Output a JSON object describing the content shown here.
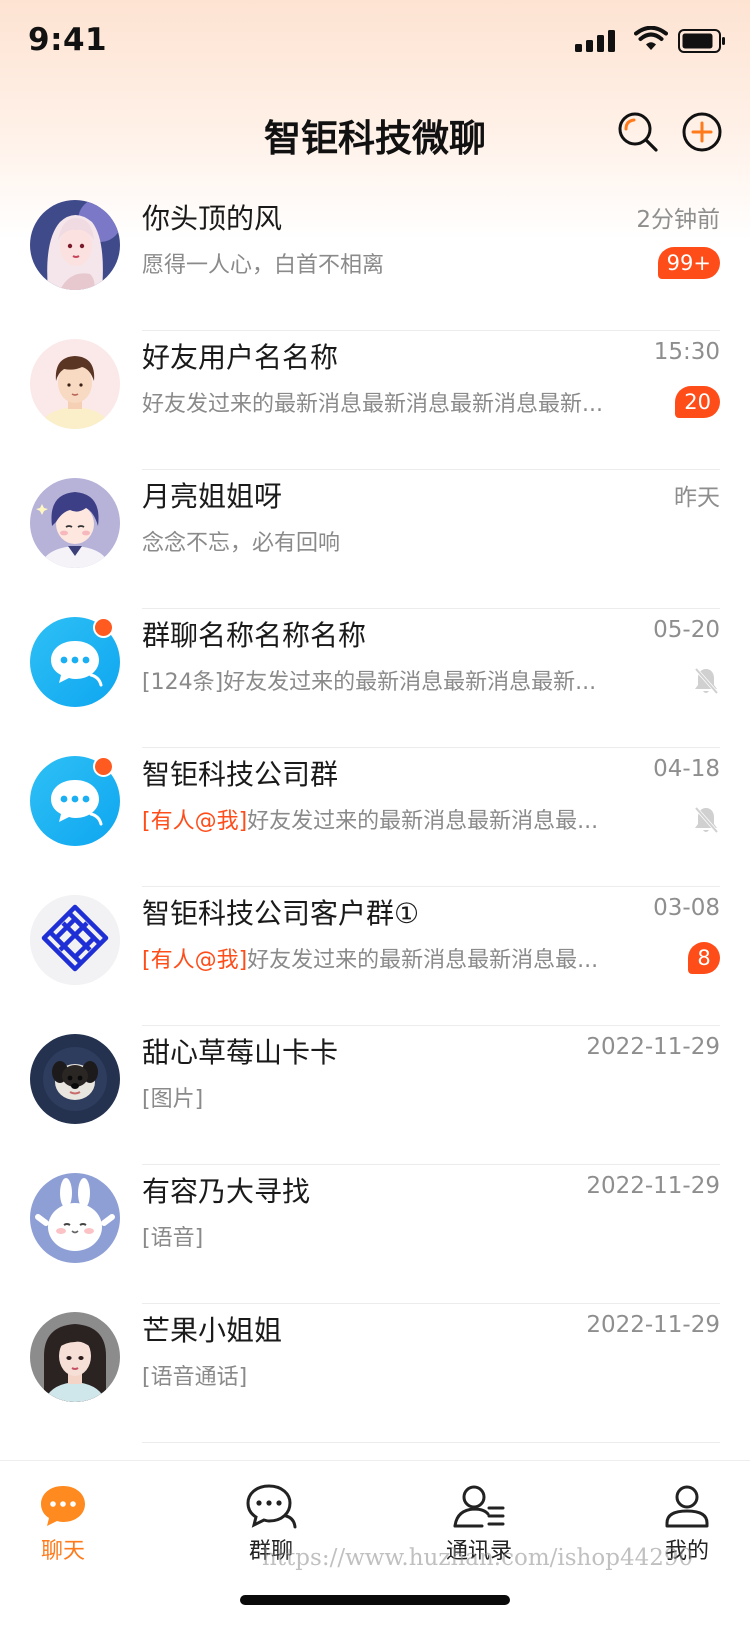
{
  "status": {
    "time": "9:41"
  },
  "header": {
    "title": "智钜科技微聊"
  },
  "icons": {
    "search": "search-icon",
    "add": "plus-circle-icon",
    "mute": "bell-off-icon"
  },
  "colors": {
    "accent": "#ff7a1a",
    "badge": "#ff4d1a",
    "mention": "#ff4d1a"
  },
  "chats": [
    {
      "name": "你头顶的风",
      "time": "2分钟前",
      "message": "愿得一人心，白首不相离",
      "mention": "",
      "badge": "99+",
      "muted": false
    },
    {
      "name": "好友用户名名称",
      "time": "15:30",
      "message": "好友发过来的最新消息最新消息最新消息最新...",
      "mention": "",
      "badge": "20",
      "muted": false
    },
    {
      "name": "月亮姐姐呀",
      "time": "昨天",
      "message": "念念不忘，必有回响",
      "mention": "",
      "badge": "",
      "muted": false
    },
    {
      "name": "群聊名称名称名称",
      "time": "05-20",
      "message": "[124条]好友发过来的最新消息最新消息最新...",
      "mention": "",
      "badge": "",
      "muted": true
    },
    {
      "name": "智钜科技公司群",
      "time": "04-18",
      "message": "好友发过来的最新消息最新消息最...",
      "mention": "[有人@我]",
      "badge": "",
      "muted": true
    },
    {
      "name": "智钜科技公司客户群①",
      "time": "03-08",
      "message": "好友发过来的最新消息最新消息最...",
      "mention": "[有人@我]",
      "badge": "8",
      "muted": false
    },
    {
      "name": "甜心草莓山卡卡",
      "time": "2022-11-29",
      "message": "[图片]",
      "mention": "",
      "badge": "",
      "muted": false
    },
    {
      "name": "有容乃大寻找",
      "time": "2022-11-29",
      "message": "[语音]",
      "mention": "",
      "badge": "",
      "muted": false
    },
    {
      "name": "芒果小姐姐",
      "time": "2022-11-29",
      "message": "[语音通话]",
      "mention": "",
      "badge": "",
      "muted": false
    }
  ],
  "tabs": [
    {
      "label": "聊天",
      "icon": "chat-bubble-filled-icon",
      "active": true
    },
    {
      "label": "群聊",
      "icon": "group-chat-icon",
      "active": false
    },
    {
      "label": "通讯录",
      "icon": "contacts-icon",
      "active": false
    },
    {
      "label": "我的",
      "icon": "profile-icon",
      "active": false
    }
  ],
  "watermark": "https://www.huzhan.com/ishop44290"
}
